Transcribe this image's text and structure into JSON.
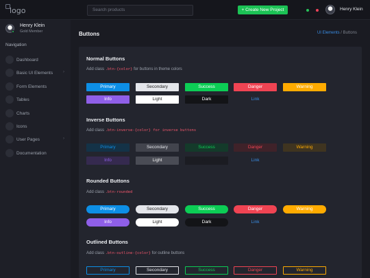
{
  "topbar": {
    "logo_alt": "logo",
    "search_placeholder": "Search products",
    "create_label": "+ Create New Project",
    "user_name": "Henry Klein"
  },
  "sidebar": {
    "user_name": "Henry Klein",
    "user_role": "Gold Member",
    "section": "Navigation",
    "items": [
      {
        "label": "Dashboard",
        "chevron": ""
      },
      {
        "label": "Basic UI Elements",
        "chevron": "›"
      },
      {
        "label": "Form Elements",
        "chevron": ""
      },
      {
        "label": "Tables",
        "chevron": ""
      },
      {
        "label": "Charts",
        "chevron": ""
      },
      {
        "label": "Icons",
        "chevron": ""
      },
      {
        "label": "User Pages",
        "chevron": "›"
      },
      {
        "label": "Documentation",
        "chevron": ""
      }
    ]
  },
  "header": {
    "title": "Buttons",
    "crumb_link": "UI Elements",
    "crumb_sep": "/",
    "crumb_current": "Buttons"
  },
  "sections": {
    "normal": {
      "title": "Normal Buttons",
      "pre": "Add class ",
      "code": ".btn-{color}",
      "post": " for buttons in theme colors"
    },
    "inverse": {
      "title": "Inverse Buttons",
      "pre": "Add class ",
      "code": ".btn-inverse-{color} for inverse buttons",
      "post": ""
    },
    "rounded": {
      "title": "Rounded Buttons",
      "pre": "Add class ",
      "code": ".btn-rounded",
      "post": ""
    },
    "outlined": {
      "title": "Outlined Buttons",
      "pre": "Add class ",
      "code": ".btn-outline-{color}",
      "post": " for outline buttons"
    }
  },
  "buttons": {
    "primary": "Primary",
    "secondary": "Secondary",
    "success": "Success",
    "danger": "Danger",
    "warning": "Warning",
    "info": "Info",
    "light": "Light",
    "dark": "Dark",
    "link": "Link"
  },
  "colors": {
    "primary": "#0d8fe6",
    "secondary": "#e4e6eb",
    "success": "#0ccd55",
    "danger": "#f04453",
    "warning": "#ffab00",
    "info": "#8f5fe8",
    "light": "#ffffff",
    "dark": "#131417",
    "link": "#3a8ee6"
  }
}
